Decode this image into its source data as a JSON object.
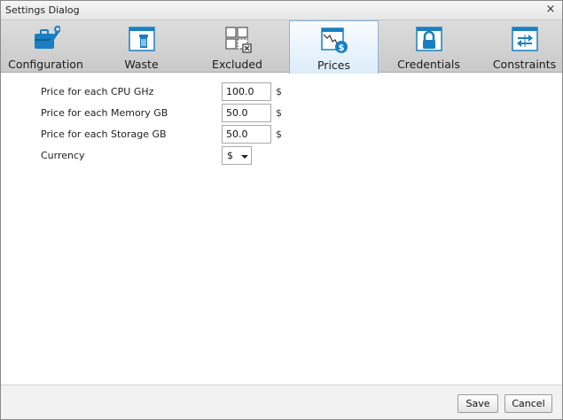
{
  "window": {
    "title": "Settings Dialog",
    "close_glyph": "×"
  },
  "tabs": [
    {
      "label": "Configuration",
      "icon": "toolbox-wrench-icon",
      "active": false
    },
    {
      "label": "Waste",
      "icon": "trash-window-icon",
      "active": false
    },
    {
      "label": "Excluded",
      "icon": "excluded-grid-icon",
      "active": false
    },
    {
      "label": "Prices",
      "icon": "price-chart-dollar-icon",
      "active": true
    },
    {
      "label": "Credentials",
      "icon": "padlock-icon",
      "active": false
    },
    {
      "label": "Constraints",
      "icon": "constraints-arrows-icon",
      "active": false
    }
  ],
  "prices": {
    "cpu": {
      "label": "Price for each CPU GHz",
      "value": "100.0",
      "unit": "$"
    },
    "memory": {
      "label": "Price for each Memory GB",
      "value": "50.0",
      "unit": "$"
    },
    "storage": {
      "label": "Price for each Storage GB",
      "value": "50.0",
      "unit": "$"
    },
    "currency": {
      "label": "Currency",
      "selected": "$"
    }
  },
  "buttons": {
    "save": "Save",
    "cancel": "Cancel"
  },
  "colors": {
    "icon_blue": "#1a7fc1",
    "active_tab_border": "#8ab4dc"
  }
}
